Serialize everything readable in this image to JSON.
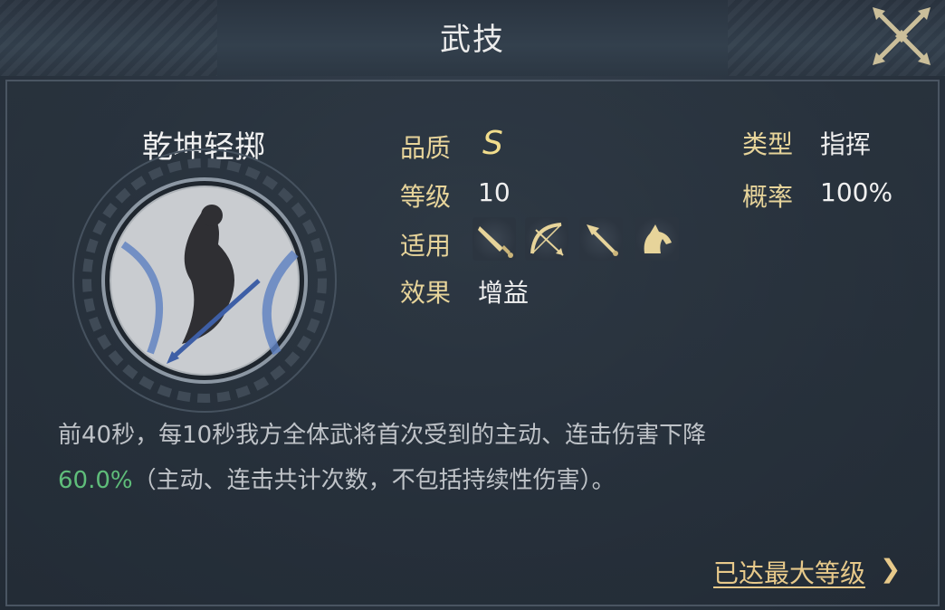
{
  "header": {
    "title": "武技"
  },
  "skill": {
    "name": "乾坤轻掷",
    "quality_label": "品质",
    "quality": "S",
    "level_label": "等级",
    "level": "10",
    "applicable_label": "适用",
    "applicable_icons": [
      "sword-icon",
      "bow-icon",
      "spear-icon",
      "horse-icon"
    ],
    "effect_label": "效果",
    "effect": "增益",
    "type_label": "类型",
    "type": "指挥",
    "rate_label": "概率",
    "rate": "100%"
  },
  "description": {
    "line1": "前40秒，每10秒我方全体武将首次受到的主动、连击伤害下降",
    "highlight": "60.0%",
    "line2": "（主动、连击共计次数，不包括持续性伤害）。"
  },
  "footer": {
    "max_level": "已达最大等级",
    "chevron": "❯"
  },
  "colors": {
    "label": "#e7d49a",
    "highlight": "#5fbd7a",
    "link": "#e7c98a"
  }
}
